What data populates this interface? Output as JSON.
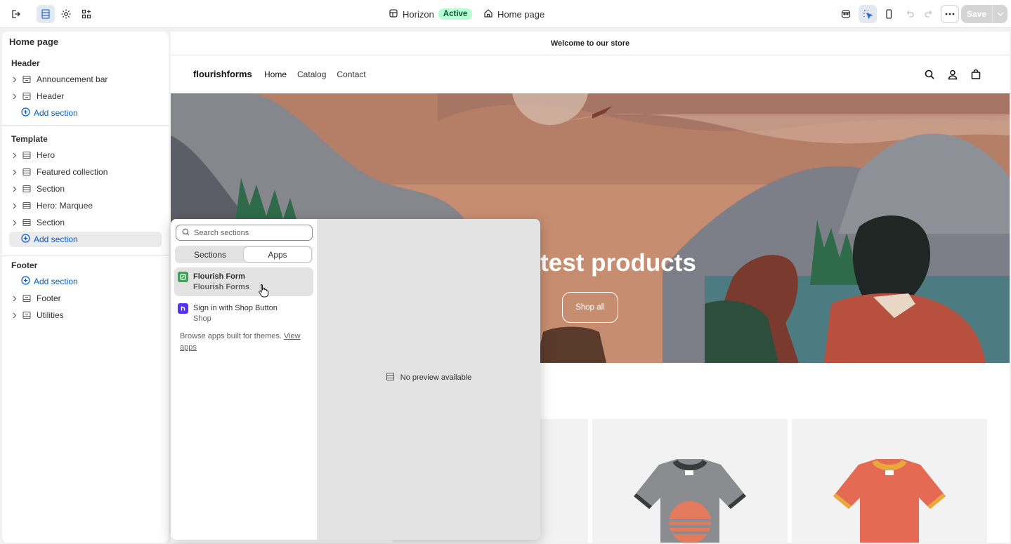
{
  "topbar": {
    "theme_name": "Horizon",
    "theme_status": "Active",
    "page": "Home page",
    "save_label": "Save"
  },
  "sidebar": {
    "title": "Home page",
    "header_group": {
      "title": "Header",
      "items": [
        "Announcement bar",
        "Header"
      ],
      "add_label": "Add section"
    },
    "template_group": {
      "title": "Template",
      "items": [
        "Hero",
        "Featured collection",
        "Section",
        "Hero: Marquee",
        "Section"
      ],
      "add_label": "Add section"
    },
    "footer_group": {
      "title": "Footer",
      "add_label": "Add section",
      "items": [
        "Footer",
        "Utilities"
      ]
    }
  },
  "store": {
    "announcement": "Welcome to our store",
    "logo": "flourishforms",
    "nav": [
      "Home",
      "Catalog",
      "Contact"
    ],
    "hero_title": "ur latest products",
    "hero_button": "Shop all"
  },
  "popover": {
    "search_placeholder": "Search sections",
    "tabs": [
      "Sections",
      "Apps"
    ],
    "active_tab": "Apps",
    "apps": [
      {
        "name": "Flourish Form",
        "developer": "Flourish Forms",
        "icon": "flourish-form-app-icon",
        "color": "#3aa655"
      },
      {
        "name": "Sign in with Shop Button",
        "developer": "Shop",
        "icon": "shop-app-icon",
        "color": "#5a31f4"
      }
    ],
    "browse_text": "Browse apps built for themes.",
    "browse_link": "View apps",
    "no_preview": "No preview available"
  },
  "colors": {
    "accent": "#005bd3",
    "badge_bg": "#b4fed2",
    "badge_text": "#0c5132"
  }
}
